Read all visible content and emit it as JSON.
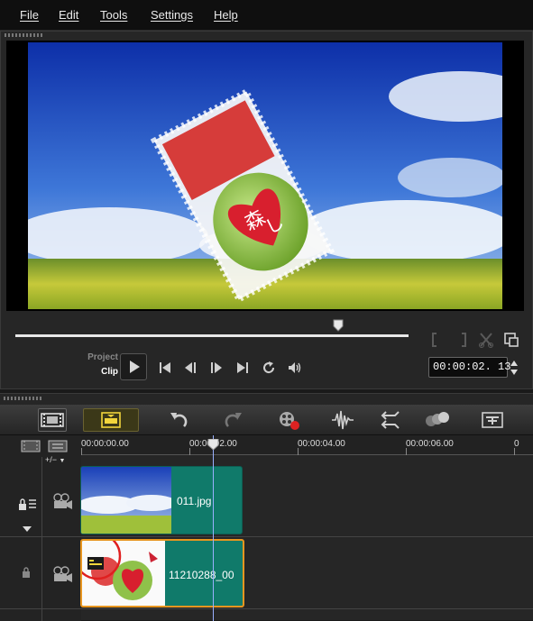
{
  "menu": {
    "file": "File",
    "edit": "Edit",
    "tools": "Tools",
    "settings": "Settings",
    "help": "Help"
  },
  "player": {
    "mode_project": "Project",
    "mode_clip": "Clip",
    "timecode": "00:00:02. 13",
    "scrubber_position": 0.82,
    "clip_text_1": "森",
    "clip_text_2": "し"
  },
  "timeline": {
    "ruler_labels": [
      "00:00:00.00",
      "00:00:02.00",
      "00:00:04.00",
      "00:00:06.00",
      "0"
    ],
    "playhead_timecode": "00:00:02.00",
    "clips": [
      {
        "label": "011.jpg",
        "track": "video",
        "kind": "image"
      },
      {
        "label": "11210288_00",
        "track": "overlay",
        "kind": "image",
        "selected": true
      }
    ],
    "add_track_label": "+/−"
  },
  "colors": {
    "clip_fill": "#107a6a",
    "clip_selected_border": "#e89620",
    "playhead": "#9ab0ff",
    "timeline_button_active": "#f2d53c"
  }
}
